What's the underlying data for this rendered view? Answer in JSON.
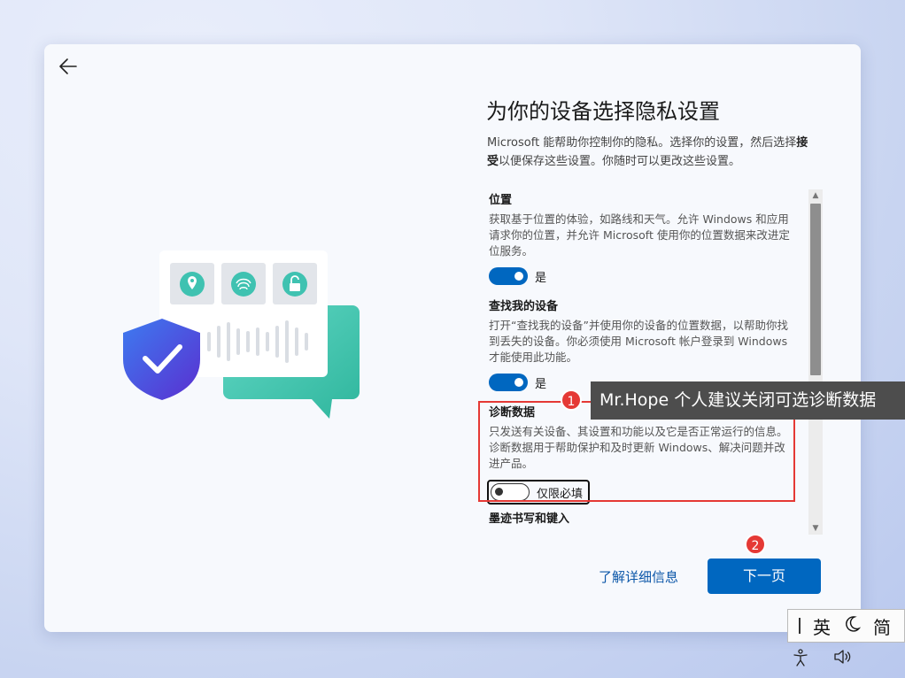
{
  "page": {
    "title": "为你的设备选择隐私设置",
    "intro_part1": "Microsoft 能帮助你控制你的隐私。选择你的设置，然后选择",
    "intro_bold": "接受",
    "intro_part2": "以便保存这些设置。你随时可以更改这些设置。"
  },
  "settings": [
    {
      "title": "位置",
      "desc": "获取基于位置的体验，如路线和天气。允许 Windows 和应用请求你的位置，并允许 Microsoft 使用你的位置数据来改进定位服务。",
      "toggle_on": true,
      "toggle_label": "是"
    },
    {
      "title": "查找我的设备",
      "desc": "打开“查找我的设备”并使用你的设备的位置数据，以帮助你找到丢失的设备。你必须使用 Microsoft 帐户登录到 Windows 才能使用此功能。",
      "toggle_on": true,
      "toggle_label": "是"
    },
    {
      "title": "诊断数据",
      "desc": "只发送有关设备、其设置和功能以及它是否正常运行的信息。诊断数据用于帮助保护和及时更新 Windows、解决问题并改进产品。",
      "toggle_on": false,
      "toggle_label": "仅限必填"
    },
    {
      "title": "墨迹书写和键入"
    }
  ],
  "annotation": {
    "badge1": "1",
    "badge2": "2",
    "tip": "Mr.Hope 个人建议关闭可选诊断数据"
  },
  "footer": {
    "learn_more": "了解详细信息",
    "next": "下一页"
  },
  "ime": {
    "lang": "英",
    "script": "简"
  },
  "colors": {
    "accent": "#0067c0",
    "annotation_red": "#e53935",
    "tip_bg": "#4d4d4d"
  }
}
